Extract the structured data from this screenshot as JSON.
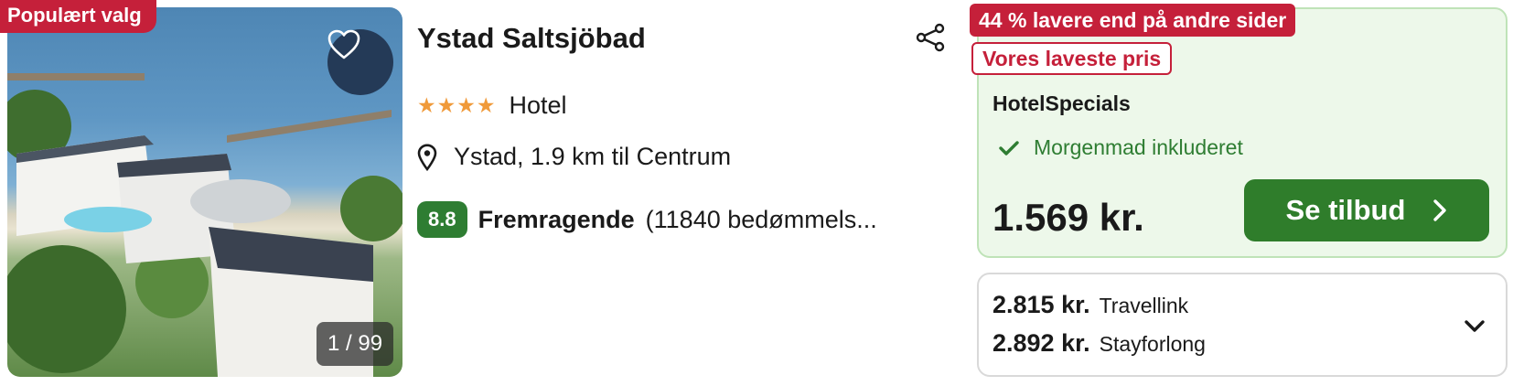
{
  "badges": {
    "popular": "Populært valg",
    "discount": "44 % lavere end på andre sider",
    "lowest": "Vores laveste pris"
  },
  "photo": {
    "counter": "1 / 99",
    "favorite_icon": "heart-outline-icon"
  },
  "hotel": {
    "name": "Ystad Saltsjöbad",
    "stars_display": "★★★★",
    "star_count": 4,
    "type": "Hotel",
    "location": "Ystad, 1.9 km til Centrum",
    "rating_score": "8.8",
    "rating_label": "Fremragende",
    "rating_count": "(11840 bedømmels..."
  },
  "deal": {
    "provider": "HotelSpecials",
    "perk": "Morgenmad inkluderet",
    "price": "1.569 kr.",
    "cta_label": "Se tilbud"
  },
  "other_prices": [
    {
      "price": "2.815 kr.",
      "provider": "Travellink"
    },
    {
      "price": "2.892 kr.",
      "provider": "Stayforlong"
    }
  ],
  "icons": {
    "share": "share-icon",
    "location": "map-pin-icon",
    "check": "check-icon",
    "cta_arrow": "chevron-right-icon",
    "expand": "chevron-down-icon"
  },
  "colors": {
    "badge_red": "#c5203a",
    "rating_green": "#2e7d32",
    "cta_green": "#2f7d2b",
    "deal_bg": "#edf8ea",
    "star_orange": "#f09a3a",
    "heart_bg": "#243a57"
  }
}
